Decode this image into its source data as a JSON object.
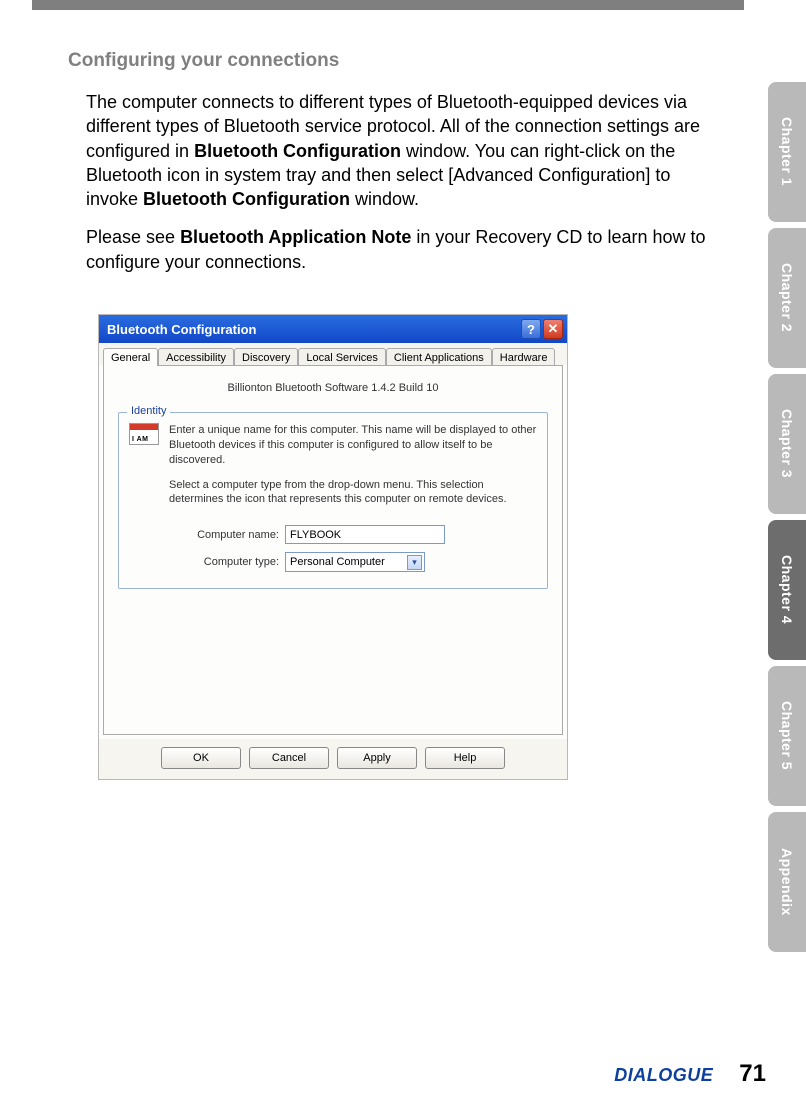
{
  "section_title": "Configuring your connections",
  "para1_pre": "The computer connects to different types of Bluetooth-equipped devices via different types of Bluetooth service protocol. All of the connection settings are configured in ",
  "para1_b1": "Bluetooth Configuration",
  "para1_mid": " window. You can right-click on the Bluetooth icon in system tray and then select [Advanced Configuration] to invoke ",
  "para1_b2": "Bluetooth Configuration",
  "para1_post": " window.",
  "para2_pre": "Please see ",
  "para2_b": "Bluetooth Application Note",
  "para2_post": " in your Recovery CD to learn how to configure your connections.",
  "side_tabs": [
    "Chapter 1",
    "Chapter 2",
    "Chapter 3",
    "Chapter 4",
    "Chapter 5",
    "Appendix"
  ],
  "active_tab_index": 3,
  "dialog": {
    "title": "Bluetooth Configuration",
    "help_glyph": "?",
    "close_glyph": "✕",
    "tabs": [
      "General",
      "Accessibility",
      "Discovery",
      "Local Services",
      "Client Applications",
      "Hardware"
    ],
    "active_tab": "General",
    "software_line": "Billionton Bluetooth Software 1.4.2 Build 10",
    "fieldset_legend": "Identity",
    "id_icon_text": "I AM",
    "identity_p1": "Enter a unique name for this computer. This name will be displayed to other Bluetooth devices if this computer is configured to allow itself to be discovered.",
    "identity_p2": "Select a computer type from the drop-down menu. This selection determines the icon that represents this computer on remote devices.",
    "computer_name_label": "Computer name:",
    "computer_name_value": "FLYBOOK",
    "computer_type_label": "Computer type:",
    "computer_type_value": "Personal Computer",
    "buttons": {
      "ok": "OK",
      "cancel": "Cancel",
      "apply": "Apply",
      "help": "Help"
    }
  },
  "footer": {
    "brand": "DIALOGUE",
    "page": "71"
  }
}
